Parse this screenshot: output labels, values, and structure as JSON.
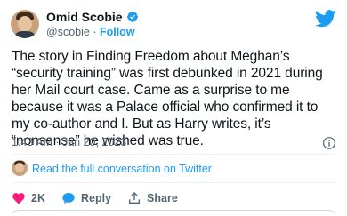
{
  "author": {
    "name": "Omid Scobie",
    "handle": "@scobie",
    "separator": "·",
    "follow_label": "Follow"
  },
  "tweet": {
    "text": "The story in Finding Freedom about Meghan’s\n“security training” was first debunked in 2021 during\nher Mail court case. Came as a surprise to me\nbecause it was a Palace official who confirmed it to\nmy co-author and I. But as Harry writes, it’s\n“nonsense” he wished was true.",
    "timestamp": "1:43 AM · Jan 20, 2023"
  },
  "conversation": {
    "link_label": "Read the full conversation on Twitter"
  },
  "actions": {
    "likes": "2K",
    "reply_label": "Reply",
    "share_label": "Share"
  },
  "colors": {
    "accent": "#1d9bf0",
    "like": "#f91880",
    "muted": "#536471"
  },
  "icons": [
    "verified-badge-icon",
    "twitter-bird-icon",
    "info-icon",
    "heart-icon",
    "reply-icon",
    "share-icon"
  ]
}
